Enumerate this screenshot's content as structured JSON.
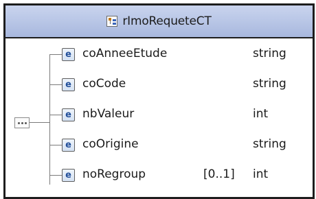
{
  "complex_type": {
    "name": "rImoRequeteCT",
    "icon": "complex-type-icon"
  },
  "compositor": {
    "icon": "sequence-icon"
  },
  "elements": [
    {
      "name": "coAnneeEtude",
      "cardinality": "",
      "type": "string",
      "icon_letter": "e"
    },
    {
      "name": "coCode",
      "cardinality": "",
      "type": "string",
      "icon_letter": "e"
    },
    {
      "name": "nbValeur",
      "cardinality": "",
      "type": "int",
      "icon_letter": "e"
    },
    {
      "name": "coOrigine",
      "cardinality": "",
      "type": "string",
      "icon_letter": "e"
    },
    {
      "name": "noRegroup",
      "cardinality": "[0..1]",
      "type": "int",
      "icon_letter": "e"
    }
  ]
}
